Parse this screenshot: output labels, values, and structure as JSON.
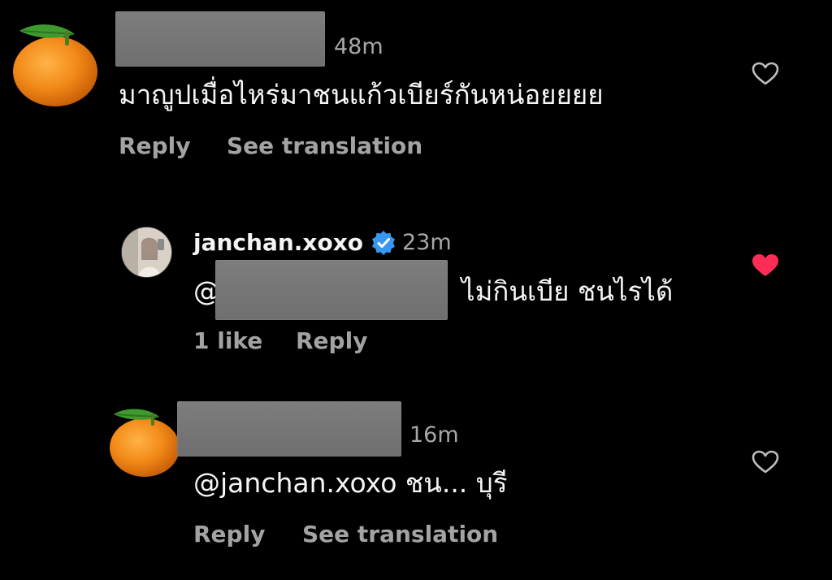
{
  "comments": [
    {
      "avatar_icon": "orange-emoji",
      "username_redacted": true,
      "time": "48m",
      "text": "มาญูปเมื่อไหร่มาชนแก้วเบียร์กันหน่อยยยย",
      "actions": {
        "reply": "Reply",
        "translate": "See translation"
      },
      "liked": false
    },
    {
      "avatar_icon": "profile-photo",
      "username": "janchan.xoxo",
      "verified": true,
      "time": "23m",
      "mention_prefix": "@",
      "mention_redacted": true,
      "text": "ไม่กินเบีย ชนไรได้",
      "actions": {
        "likes": "1 like",
        "reply": "Reply"
      },
      "liked": true
    },
    {
      "avatar_icon": "orange-emoji",
      "username_redacted": true,
      "time": "16m",
      "text": "@janchan.xoxo ชน... บุรี",
      "actions": {
        "reply": "Reply",
        "translate": "See translation"
      },
      "liked": false
    }
  ],
  "colors": {
    "background": "#000000",
    "secondary_text": "#a8a8a8",
    "heart_liked": "#ff2d55",
    "verified_badge": "#3897f0"
  }
}
